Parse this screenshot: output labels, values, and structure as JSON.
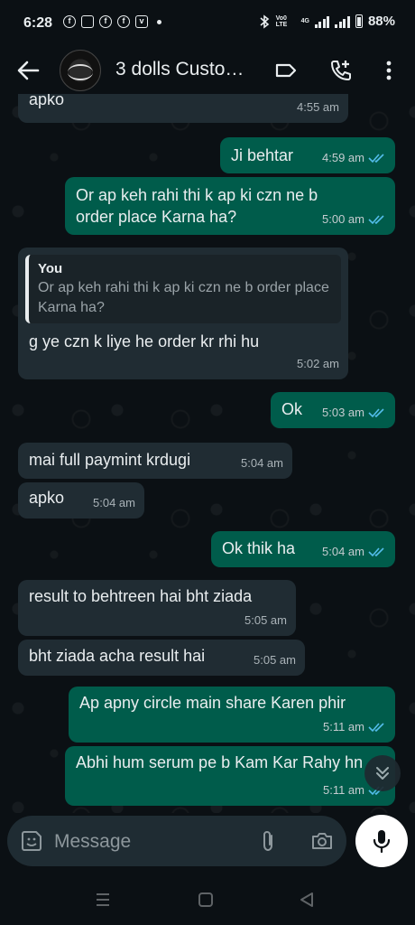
{
  "status_bar": {
    "time": "6:28",
    "network": "Vo0 LTE",
    "network_type": "4G",
    "battery": "88%"
  },
  "header": {
    "contact_name": "3 dolls Custo…",
    "icons": [
      "back-arrow-icon",
      "avatar",
      "label-icon",
      "add-call-icon",
      "more-vert-icon"
    ]
  },
  "messages": [
    {
      "dir": "in",
      "text": "apko",
      "time": "4:55 am"
    },
    {
      "dir": "out",
      "text": "Ji behtar",
      "time": "4:59 am",
      "status": "read"
    },
    {
      "dir": "out",
      "text": "Or ap keh rahi thi k ap ki czn ne b order place Karna ha?",
      "time": "5:00 am",
      "status": "read"
    },
    {
      "dir": "in",
      "quote_author": "You",
      "quote_text": "Or ap keh rahi thi k ap ki czn ne b order place Karna ha?",
      "text": "g ye czn k liye he order kr rhi hu",
      "time": "5:02 am"
    },
    {
      "dir": "out",
      "text": "Ok",
      "time": "5:03 am",
      "status": "read"
    },
    {
      "dir": "in",
      "text": "mai full paymint krdugi",
      "time": "5:04 am"
    },
    {
      "dir": "in",
      "text": "apko",
      "time": "5:04 am"
    },
    {
      "dir": "out",
      "text": "Ok thik ha",
      "time": "5:04 am",
      "status": "read"
    },
    {
      "dir": "in",
      "text": "result to behtreen hai bht ziada",
      "time": "5:05 am"
    },
    {
      "dir": "in",
      "text": "bht ziada acha result hai",
      "time": "5:05 am"
    },
    {
      "dir": "out",
      "text": "Ap apny circle main share Karen phir",
      "time": "5:11 am",
      "status": "read"
    },
    {
      "dir": "out",
      "text": "Abhi hum serum pe b Kam Kar Rahy hn",
      "time": "5:11 am",
      "status": "read"
    }
  ],
  "composer": {
    "placeholder": "Message"
  },
  "colors": {
    "background": "#0b1014",
    "incoming_bubble": "#202c33",
    "outgoing_bubble": "#005c4b",
    "read_ticks": "#53bdeb"
  }
}
